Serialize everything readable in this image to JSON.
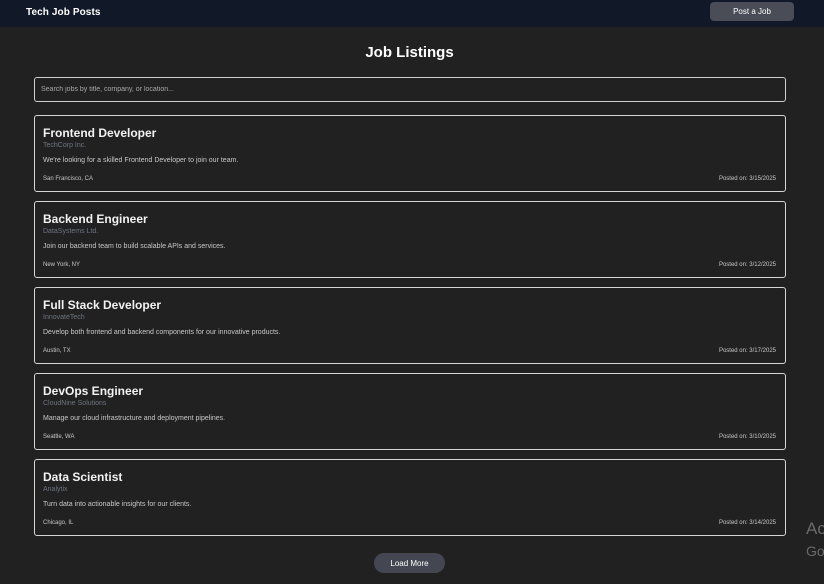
{
  "header": {
    "brand": "Tech Job Posts",
    "post_button": "Post a Job"
  },
  "main": {
    "title": "Job Listings",
    "search_placeholder": "Search jobs by title, company, or location...",
    "jobs": [
      {
        "title": "Frontend Developer",
        "company": "TechCorp Inc.",
        "description": "We're looking for a skilled Frontend Developer to join our team.",
        "location": "San Francisco, CA",
        "posted": "Posted on: 3/15/2025"
      },
      {
        "title": "Backend Engineer",
        "company": "DataSystems Ltd.",
        "description": "Join our backend team to build scalable APIs and services.",
        "location": "New York, NY",
        "posted": "Posted on: 3/12/2025"
      },
      {
        "title": "Full Stack Developer",
        "company": "InnovateTech",
        "description": "Develop both frontend and backend components for our innovative products.",
        "location": "Austin, TX",
        "posted": "Posted on: 3/17/2025"
      },
      {
        "title": "DevOps Engineer",
        "company": "CloudNine Solutions",
        "description": "Manage our cloud infrastructure and deployment pipelines.",
        "location": "Seattle, WA",
        "posted": "Posted on: 3/10/2025"
      },
      {
        "title": "Data Scientist",
        "company": "Analytix",
        "description": "Turn data into actionable insights for our clients.",
        "location": "Chicago, IL",
        "posted": "Posted on: 3/14/2025"
      }
    ],
    "load_more": "Load More"
  },
  "watermark": {
    "line1": "Ac",
    "line2": "Go"
  },
  "colors": {
    "background": "#212121",
    "header_bg": "#111827",
    "button_bg": "#4a4d57",
    "card_border": "#d6d6d6",
    "company_text": "#6f7480"
  }
}
